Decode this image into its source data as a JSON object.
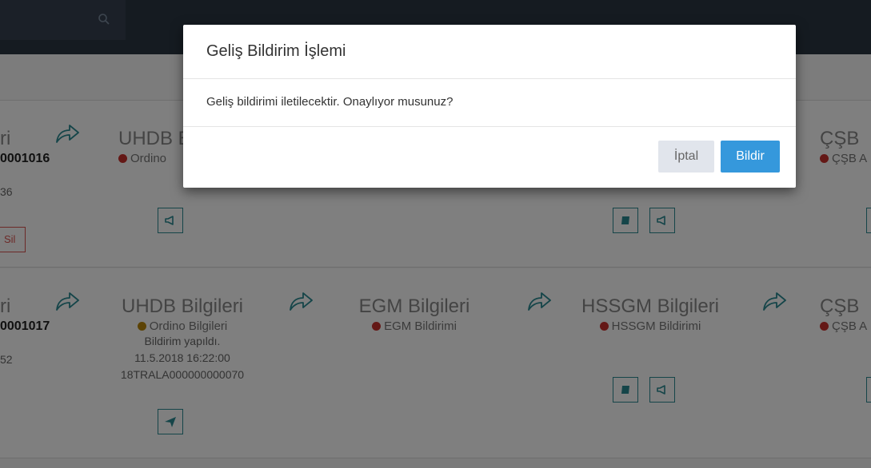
{
  "modal": {
    "title": "Geliş Bildirim İşlemi",
    "message": "Geliş bildirimi iletilecektir. Onaylıyor musunuz?",
    "cancel_label": "İptal",
    "confirm_label": "Bildir"
  },
  "row1": {
    "left_title": "ri",
    "left_number": "0001016",
    "left_small": "36",
    "left_button": "Sil",
    "uhdb_title": "UHDB B",
    "uhdb_status": "Ordino",
    "csb_title": "ÇŞB",
    "csb_status": "ÇŞB A"
  },
  "row2": {
    "left_title": "ri",
    "left_number": "0001017",
    "left_small": "52",
    "uhdb_title": "UHDB Bilgileri",
    "uhdb_status": "Ordino Bilgileri",
    "uhdb_line1": "Bildirim yapıldı.",
    "uhdb_line2": "11.5.2018 16:22:00",
    "uhdb_line3": "18TRALA000000000070",
    "egm_title": "EGM Bilgileri",
    "egm_status": "EGM Bildirimi",
    "hssgm_title": "HSSGM Bilgileri",
    "hssgm_status": "HSSGM Bildirimi",
    "csb_title": "ÇŞB",
    "csb_status": "ÇŞB A"
  },
  "colors": {
    "accent": "#3598dc",
    "teal": "#2a8a93",
    "danger": "#d9534f",
    "topbar": "#2b3643"
  },
  "icons": [
    "search-icon",
    "share-arrow-icon",
    "megaphone-icon",
    "book-icon",
    "paper-plane-icon"
  ]
}
